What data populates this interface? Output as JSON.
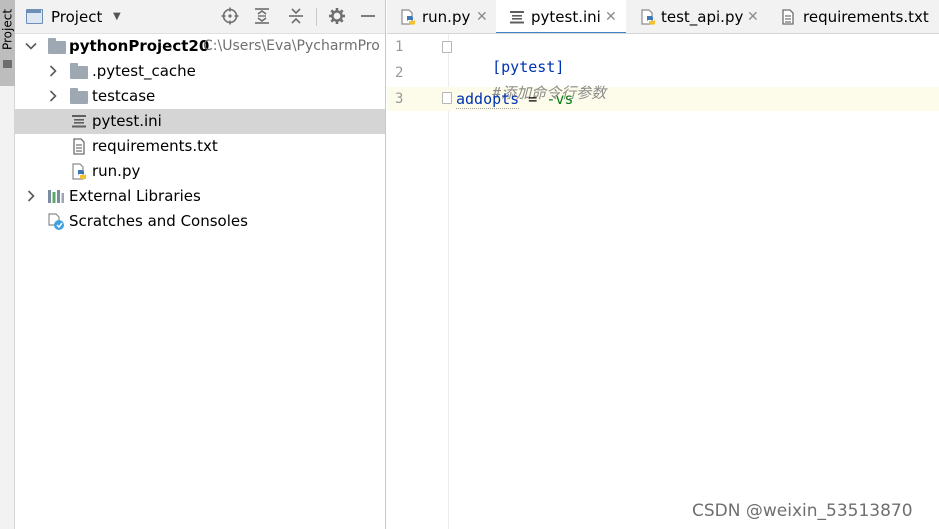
{
  "side_stripe": {
    "label": "Project"
  },
  "project_pane": {
    "title": "Project",
    "dropdown": "▼"
  },
  "tree": {
    "root": {
      "name": "pythonProject20",
      "path": "C:\\Users\\Eva\\PycharmPro"
    },
    "items": [
      {
        "name": ".pytest_cache",
        "kind": "folder",
        "collapsed": true
      },
      {
        "name": "testcase",
        "kind": "folder",
        "collapsed": true
      },
      {
        "name": "pytest.ini",
        "kind": "ini",
        "selected": true
      },
      {
        "name": "requirements.txt",
        "kind": "text"
      },
      {
        "name": "run.py",
        "kind": "python"
      }
    ],
    "external_libraries": "External Libraries",
    "scratches": "Scratches and Consoles"
  },
  "tabs": [
    {
      "label": "run.py",
      "icon": "python-file-icon",
      "close": "✕"
    },
    {
      "label": "pytest.ini",
      "icon": "ini-file-icon",
      "close": "✕",
      "active": true
    },
    {
      "label": "test_api.py",
      "icon": "python-file-icon",
      "close": "✕"
    },
    {
      "label": "requirements.txt",
      "icon": "text-file-icon"
    }
  ],
  "editor": {
    "line_numbers": [
      "1",
      "2",
      "3"
    ],
    "line1": "[pytest]",
    "line2": "#添加命令行参数",
    "line3_key": "addopts",
    "line3_op": " = ",
    "line3_value": "-vs"
  },
  "watermark": "CSDN @weixin_53513870",
  "colors": {
    "accent": "#4083c9",
    "selection": "#d5d5d5",
    "current_line": "#fdfbe9",
    "keyword": "#0033b3",
    "comment": "#8c8c8c",
    "value": "#067d17"
  }
}
